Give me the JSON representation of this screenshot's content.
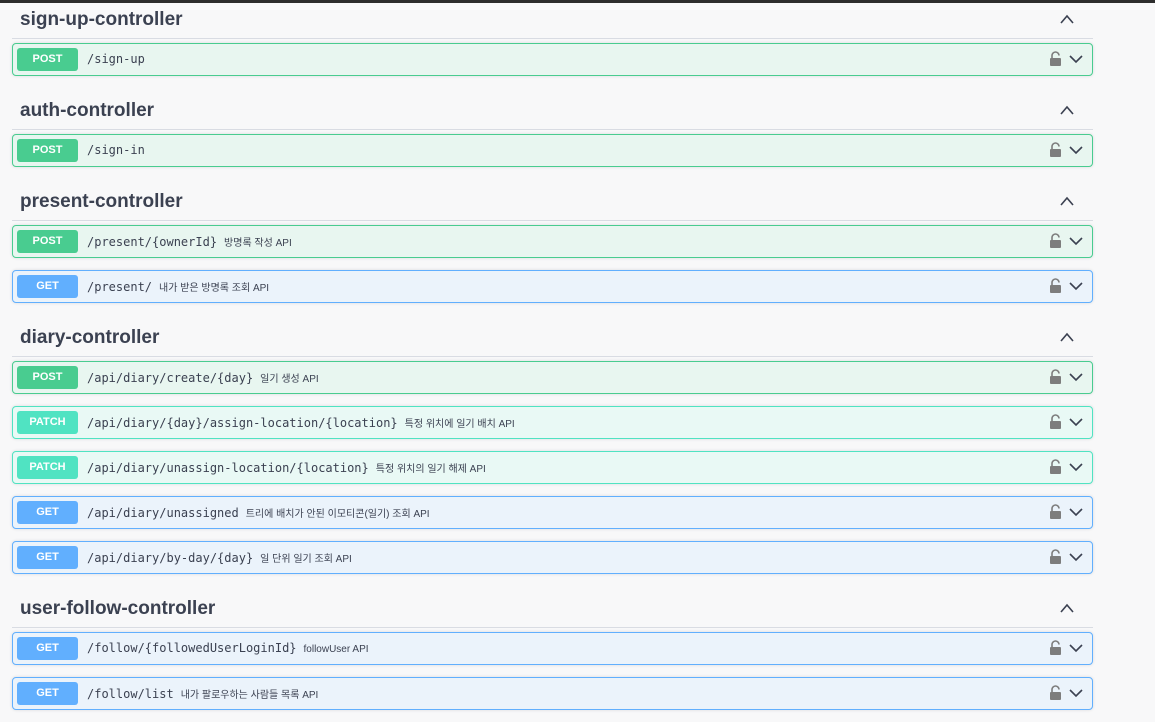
{
  "groups": [
    {
      "title": "sign-up-controller",
      "ops": [
        {
          "method": "POST",
          "path": "/sign-up",
          "desc": ""
        }
      ]
    },
    {
      "title": "auth-controller",
      "ops": [
        {
          "method": "POST",
          "path": "/sign-in",
          "desc": ""
        }
      ]
    },
    {
      "title": "present-controller",
      "ops": [
        {
          "method": "POST",
          "path": "/present/{ownerId}",
          "desc": "방명록 작성 API"
        },
        {
          "method": "GET",
          "path": "/present/",
          "desc": "내가 받은 방명록 조회 API"
        }
      ]
    },
    {
      "title": "diary-controller",
      "ops": [
        {
          "method": "POST",
          "path": "/api/diary/create/{day}",
          "desc": "일기 생성 API"
        },
        {
          "method": "PATCH",
          "path": "/api/diary/{day}/assign-location/{location}",
          "desc": "특정 위치에 일기 배치 API"
        },
        {
          "method": "PATCH",
          "path": "/api/diary/unassign-location/{location}",
          "desc": "특정 위치의 일기 해제 API"
        },
        {
          "method": "GET",
          "path": "/api/diary/unassigned",
          "desc": "트리에 배치가 안된 이모티콘(일기) 조회 API"
        },
        {
          "method": "GET",
          "path": "/api/diary/by-day/{day}",
          "desc": "일 단위 일기 조회 API"
        }
      ]
    },
    {
      "title": "user-follow-controller",
      "ops": [
        {
          "method": "GET",
          "path": "/follow/{followedUserLoginId}",
          "desc": "followUser API"
        },
        {
          "method": "GET",
          "path": "/follow/list",
          "desc": "내가 팔로우하는 사람들 목록 API"
        }
      ]
    }
  ],
  "icons": {
    "lock": "lock-icon",
    "chevron": "chevron-down-icon",
    "collapse": "chevron-up-icon"
  },
  "colors": {
    "post": "#49cc90",
    "get": "#61affe",
    "patch": "#50e3c2"
  }
}
